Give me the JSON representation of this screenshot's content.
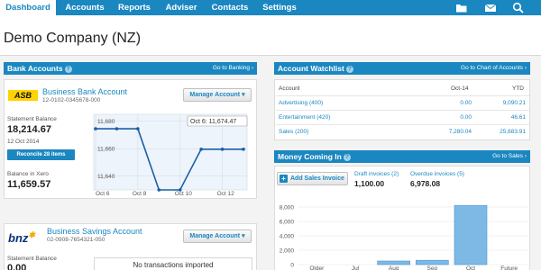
{
  "nav": {
    "tabs": [
      {
        "label": "Dashboard",
        "active": true
      },
      {
        "label": "Accounts"
      },
      {
        "label": "Reports"
      },
      {
        "label": "Adviser"
      },
      {
        "label": "Contacts"
      },
      {
        "label": "Settings"
      }
    ],
    "icons": [
      "folder-icon",
      "mail-icon",
      "search-icon"
    ]
  },
  "header": {
    "title": "Demo Company (NZ)"
  },
  "bank_accounts": {
    "title": "Bank Accounts",
    "link": "Go to Banking ›",
    "accounts": [
      {
        "logo": "ASB",
        "name": "Business Bank Account",
        "number": "12-0102-0345678-000",
        "manage_label": "Manage Account ▾",
        "statement_label": "Statement Balance",
        "statement_balance": "18,214.67",
        "statement_date": "12 Oct 2014",
        "reconcile_label": "Reconcile 28 items",
        "xero_label": "Balance in Xero",
        "xero_balance": "11,659.57",
        "chart": {
          "tooltip": "Oct 6: 11,674.47",
          "y_ticks": [
            "11,680",
            "11,660",
            "11,640"
          ],
          "x_ticks": [
            "Oct 6",
            "Oct 8",
            "Oct 10",
            "Oct 12"
          ]
        }
      },
      {
        "logo": "bnz",
        "name": "Business Savings Account",
        "number": "02-0908-7654321-050",
        "manage_label": "Manage Account ▾",
        "statement_label": "Statement Balance",
        "statement_balance": "0.00",
        "no_tx": "No transactions imported"
      }
    ]
  },
  "watchlist": {
    "title": "Account Watchlist",
    "link": "Go to Chart of Accounts ›",
    "headers": {
      "account": "Account",
      "month": "Oct-14",
      "ytd": "YTD"
    },
    "rows": [
      {
        "account": "Advertising (400)",
        "month": "0.00",
        "ytd": "9,090.21"
      },
      {
        "account": "Entertainment (420)",
        "month": "0.00",
        "ytd": "46.61"
      },
      {
        "account": "Sales (200)",
        "month": "7,280.04",
        "ytd": "25,683.91"
      }
    ]
  },
  "money_in": {
    "title": "Money Coming In",
    "link": "Go to Sales ›",
    "add_label": "Add Sales Invoice",
    "draft_label": "Draft invoices (2)",
    "draft_value": "1,100.00",
    "overdue_label": "Overdue invoices (5)",
    "overdue_value": "6,978.08"
  },
  "chart_data": [
    {
      "type": "line",
      "title": "",
      "x": [
        "Oct 6",
        "Oct 7",
        "Oct 8",
        "Oct 9",
        "Oct 10",
        "Oct 11",
        "Oct 12",
        "Oct 13"
      ],
      "series": [
        {
          "values": [
            11674.47,
            11674.47,
            11674.47,
            11630,
            11630,
            11659.57,
            11659.57,
            11659.57
          ]
        }
      ],
      "ylim": [
        11630,
        11685
      ],
      "y_ticks": [
        11680,
        11660,
        11640
      ],
      "x_ticks": [
        "Oct 6",
        "Oct 8",
        "Oct 10",
        "Oct 12"
      ],
      "grid": true
    },
    {
      "type": "bar",
      "title": "",
      "categories": [
        "Older",
        "Jul",
        "Aug",
        "Sep",
        "Oct",
        "Future"
      ],
      "values": [
        0,
        0,
        500,
        600,
        8200,
        0
      ],
      "ylim": [
        0,
        9000
      ],
      "y_ticks": [
        0,
        2000,
        4000,
        6000,
        8000
      ],
      "grid": true
    }
  ]
}
